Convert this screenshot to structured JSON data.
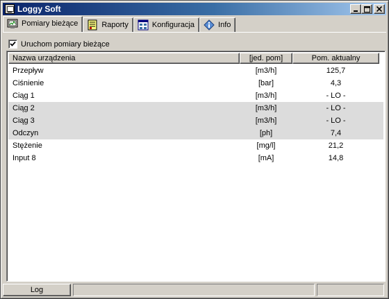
{
  "window": {
    "title": "Loggy Soft"
  },
  "caption_buttons": {
    "minimize": "_",
    "maximize": "□",
    "close": "×"
  },
  "tabs": [
    {
      "label": "Pomiary bieżące",
      "icon": "monitor-icon",
      "active": true
    },
    {
      "label": "Raporty",
      "icon": "report-icon",
      "active": false
    },
    {
      "label": "Konfiguracja",
      "icon": "config-icon",
      "active": false
    },
    {
      "label": "Info",
      "icon": "info-diamond-icon",
      "active": false
    }
  ],
  "checkbox": {
    "label": "Uruchom pomiary bieżące",
    "checked": true
  },
  "list": {
    "columns": [
      "Nazwa urządzenia",
      "[jed. pom]",
      "Pom. aktualny"
    ],
    "rows": [
      {
        "name": "Przepływ",
        "unit": "[m3/h]",
        "value": "125,7",
        "shaded": false
      },
      {
        "name": "Ciśnienie",
        "unit": "[bar]",
        "value": "4,3",
        "shaded": false
      },
      {
        "name": "Ciąg 1",
        "unit": "[m3/h]",
        "value": "- LO -",
        "shaded": false
      },
      {
        "name": "Ciąg 2",
        "unit": "[m3/h]",
        "value": "- LO -",
        "shaded": true
      },
      {
        "name": "Ciąg 3",
        "unit": "[m3/h]",
        "value": "- LO -",
        "shaded": true
      },
      {
        "name": "Odczyn",
        "unit": "[ph]",
        "value": "7,4",
        "shaded": true
      },
      {
        "name": "Stężenie",
        "unit": "[mg/l]",
        "value": "21,2",
        "shaded": false
      },
      {
        "name": "Input 8",
        "unit": "[mA]",
        "value": "14,8",
        "shaded": false
      }
    ]
  },
  "statusbar": {
    "log_label": "Log"
  },
  "colors": {
    "titlebar_start": "#0a246a",
    "titlebar_end": "#a6caf0",
    "face": "#d4d0c8",
    "row_shade": "#dcdcdc"
  }
}
